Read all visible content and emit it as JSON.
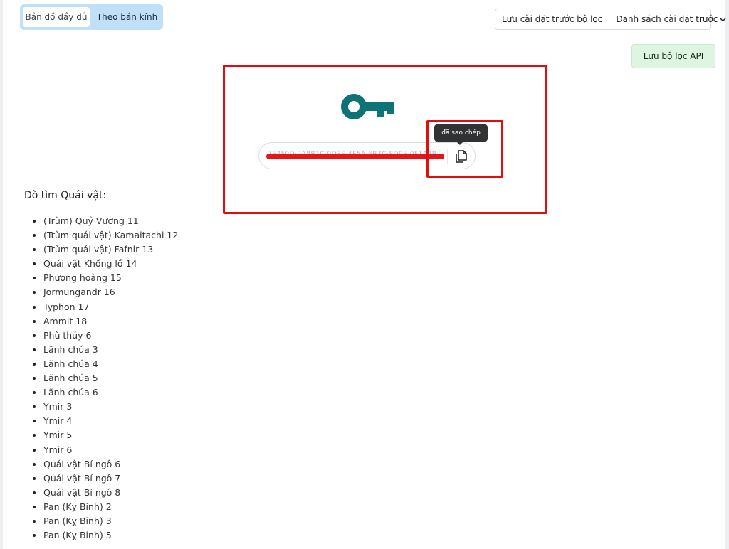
{
  "tabs": {
    "full_map": "Bản đồ đầy đủ",
    "by_radius": "Theo bán kính"
  },
  "presets": {
    "save_label": "Lưu cài đặt trước bộ lọc",
    "list_label": "Danh sách cài đặt trước"
  },
  "api_button": "Lưu bộ lọc API",
  "api_key": {
    "value": "7E4F0D·2A8B1C·9D3E·4F5A·6B7C·8D9E·0F1A2B",
    "tooltip": "đã sao chép"
  },
  "section_title": "Dò tìm Quái vật:",
  "monsters": [
    "(Trùm) Quỷ Vương 11",
    "(Trùm quái vật) Kamaitachi 12",
    "(Trùm quái vật) Fafnir 13",
    "Quái vật Khổng lồ 14",
    "Phượng hoàng 15",
    "Jormungandr 16",
    "Typhon 17",
    "Ammit 18",
    "Phù thủy 6",
    "Lãnh chúa 3",
    "Lãnh chúa 4",
    "Lãnh chúa 5",
    "Lãnh chúa 6",
    "Ymir 3",
    "Ymir 4",
    "Ymir 5",
    "Ymir 6",
    "Quái vật Bí ngô 6",
    "Quái vật Bí ngô 7",
    "Quái vật Bí ngô 8",
    "Pan (Kỵ Binh) 2",
    "Pan (Kỵ Binh) 3",
    "Pan (Kỵ Binh) 5"
  ],
  "colors": {
    "accent_teal": "#0e7377",
    "annotation_red": "#e30d0d",
    "tab_bg": "#bfe0f8",
    "api_button_bg": "#def5e2"
  },
  "icons": {
    "key": "key-icon",
    "copy": "copy-icon",
    "chevron": "chevron-down-icon"
  }
}
